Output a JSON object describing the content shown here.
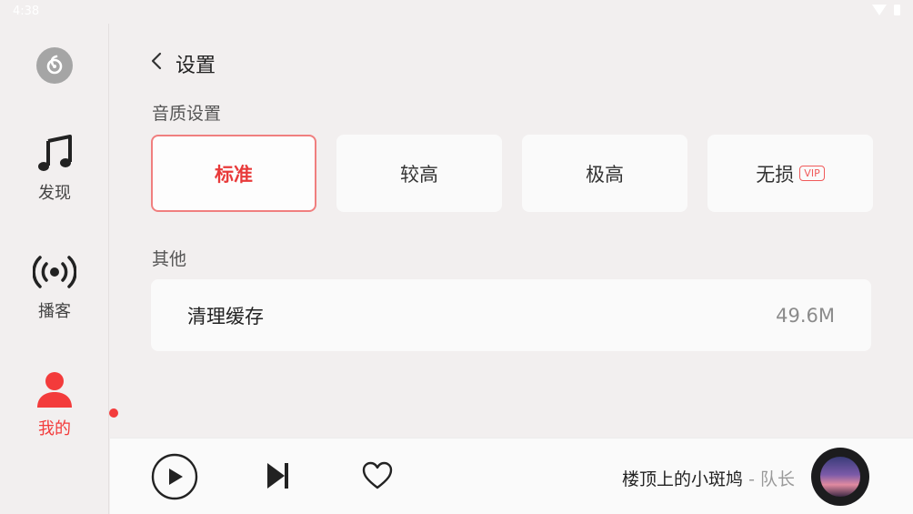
{
  "status_bar": {
    "time": "4:38"
  },
  "sidebar": {
    "items": [
      {
        "label": "发现",
        "icon": "music-note-icon",
        "active": false
      },
      {
        "label": "播客",
        "icon": "broadcast-icon",
        "active": false
      },
      {
        "label": "我的",
        "icon": "user-icon",
        "active": true
      }
    ]
  },
  "header": {
    "title": "设置"
  },
  "quality": {
    "section_title": "音质设置",
    "options": [
      {
        "label": "标准",
        "selected": true
      },
      {
        "label": "较高",
        "selected": false
      },
      {
        "label": "极高",
        "selected": false
      },
      {
        "label": "无损",
        "selected": false,
        "badge": "VIP"
      }
    ]
  },
  "other": {
    "section_title": "其他",
    "cache_label": "清理缓存",
    "cache_size": "49.6M"
  },
  "player": {
    "song_title": "楼顶上的小斑鸠",
    "separator": " - ",
    "artist": "队长"
  },
  "colors": {
    "accent": "#f33b3b",
    "selected_border": "#f07f7f",
    "background": "#f2efef",
    "card": "#fafafa"
  }
}
